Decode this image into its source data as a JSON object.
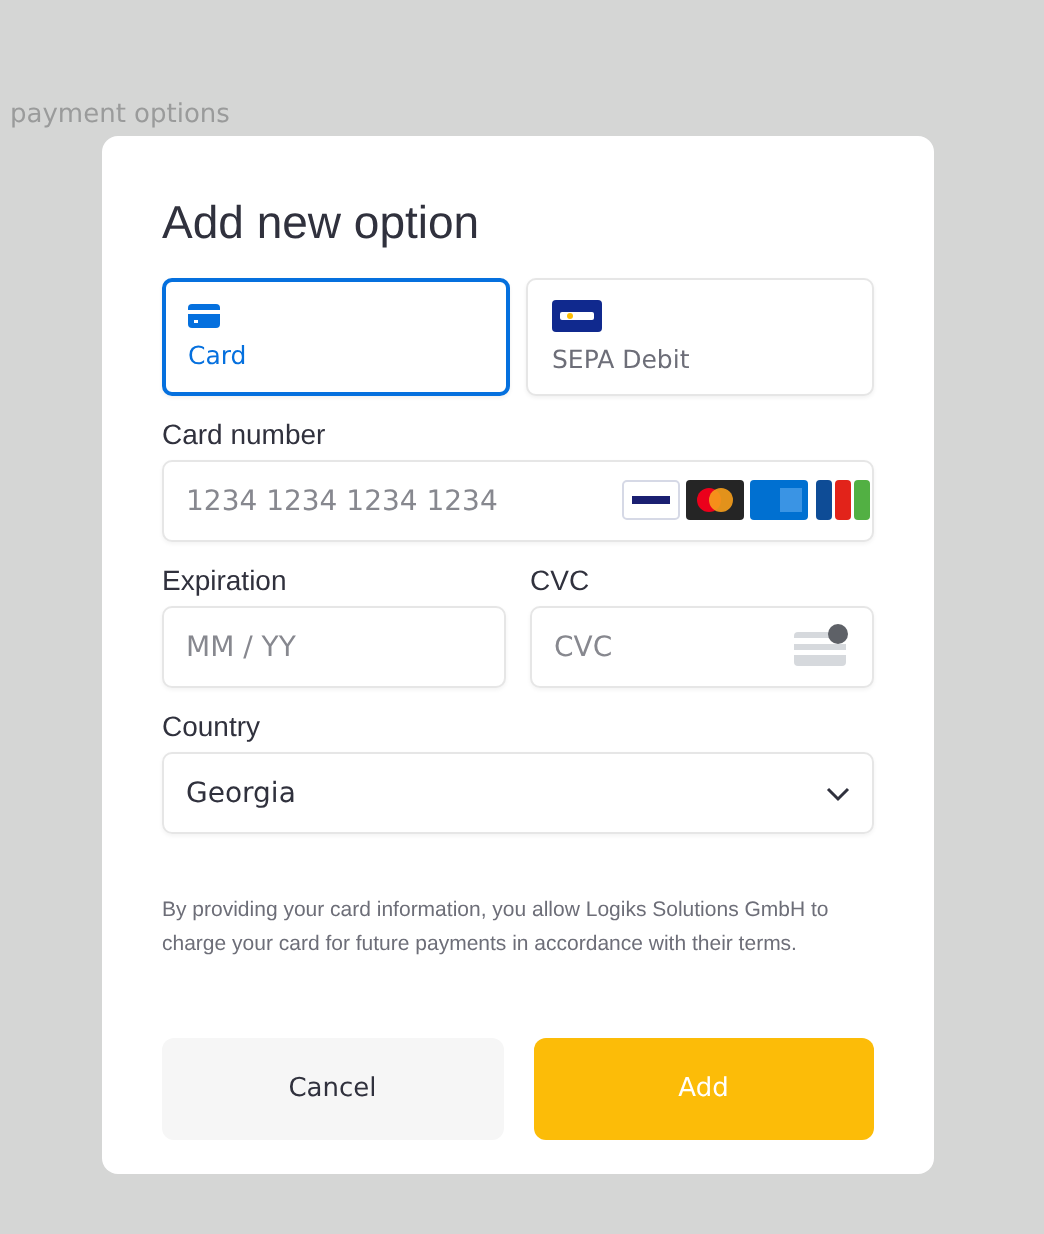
{
  "background": {
    "heading": "payment options"
  },
  "dialog": {
    "title": "Add new option",
    "tabs": [
      {
        "label": "Card",
        "kind": "card",
        "selected": true
      },
      {
        "label": "SEPA Debit",
        "kind": "sepa",
        "selected": false
      }
    ],
    "card_number": {
      "label": "Card number",
      "placeholder": "1234 1234 1234 1234"
    },
    "expiration": {
      "label": "Expiration",
      "placeholder": "MM / YY"
    },
    "cvc": {
      "label": "CVC",
      "placeholder": "CVC"
    },
    "country": {
      "label": "Country",
      "value": "Georgia"
    },
    "notice": "By providing your card information, you allow Logiks Solutions GmbH to charge your card for future payments in accordance with their terms.",
    "buttons": [
      {
        "label": "Cancel",
        "kind": "secondary"
      },
      {
        "label": "Add",
        "kind": "primary"
      }
    ]
  }
}
